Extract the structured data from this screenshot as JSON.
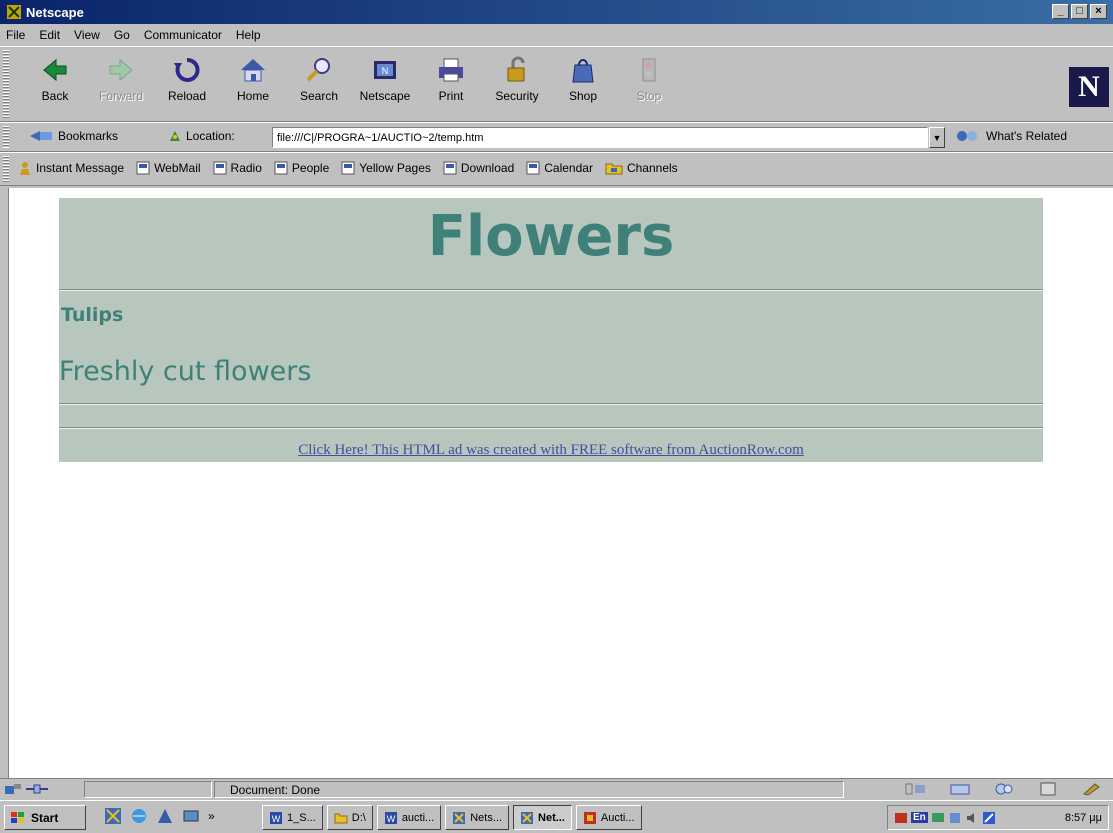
{
  "window": {
    "title": "Netscape",
    "controls": [
      "_",
      "□",
      "×"
    ]
  },
  "menu": [
    "File",
    "Edit",
    "View",
    "Go",
    "Communicator",
    "Help"
  ],
  "nav_toolbar": [
    {
      "label": "Back",
      "icon": "back-arrow-icon",
      "enabled": true
    },
    {
      "label": "Forward",
      "icon": "forward-arrow-icon",
      "enabled": false
    },
    {
      "label": "Reload",
      "icon": "reload-icon",
      "enabled": true
    },
    {
      "label": "Home",
      "icon": "home-icon",
      "enabled": true
    },
    {
      "label": "Search",
      "icon": "search-icon",
      "enabled": true
    },
    {
      "label": "Netscape",
      "icon": "netscape-icon",
      "enabled": true
    },
    {
      "label": "Print",
      "icon": "print-icon",
      "enabled": true
    },
    {
      "label": "Security",
      "icon": "lock-icon",
      "enabled": true
    },
    {
      "label": "Shop",
      "icon": "shop-icon",
      "enabled": true
    },
    {
      "label": "Stop",
      "icon": "stop-icon",
      "enabled": false
    }
  ],
  "location": {
    "bookmarks_label": "Bookmarks",
    "location_label": "Location:",
    "url": "file:///C|/PROGRA~1/AUCTIO~2/temp.htm",
    "related_label": "What's Related"
  },
  "personal_toolbar": [
    "Instant Message",
    "WebMail",
    "Radio",
    "People",
    "Yellow Pages",
    "Download",
    "Calendar",
    "Channels"
  ],
  "ad": {
    "title": "Flowers",
    "subtitle": "Tulips",
    "description": "Freshly cut flowers",
    "link": "Click Here! This HTML ad was created with FREE software from AuctionRow.com",
    "bg_color": "#b7c7bd",
    "text_color": "#3f8079"
  },
  "status": {
    "text": "Document: Done"
  },
  "taskbar": {
    "start_label": "Start",
    "quick_more": "»",
    "tasks": [
      {
        "label": "1_S...",
        "active": false
      },
      {
        "label": "D:\\",
        "active": false
      },
      {
        "label": "aucti...",
        "active": false
      },
      {
        "label": "Nets...",
        "active": false
      },
      {
        "label": "Net...",
        "active": true
      },
      {
        "label": "Aucti...",
        "active": false
      }
    ],
    "tray_lang": "En",
    "clock": "8:57 μμ"
  }
}
